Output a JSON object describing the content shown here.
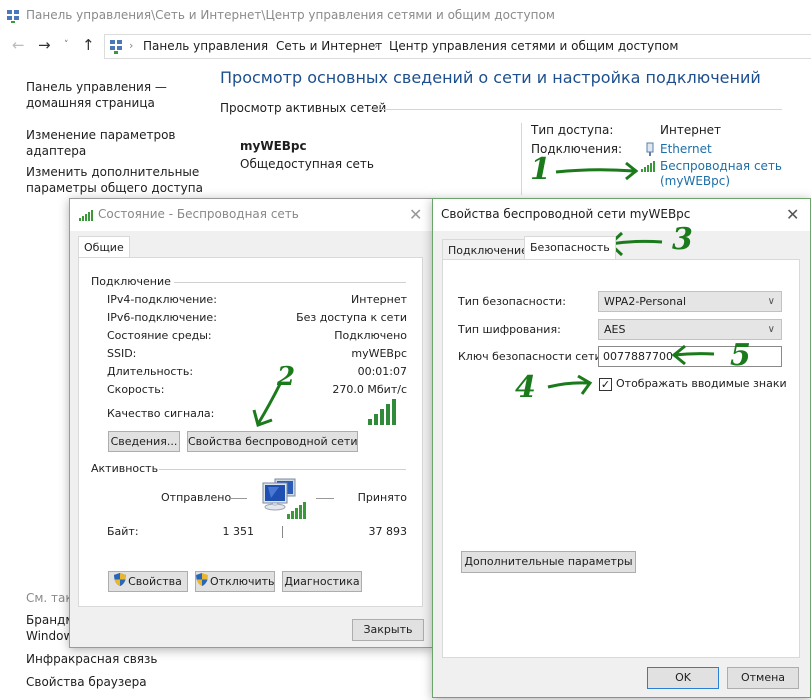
{
  "window": {
    "title": "Панель управления\\Сеть и Интернет\\Центр управления сетями и общим доступом",
    "nav": {
      "back_icon": "arrow-left-icon",
      "forward_icon": "arrow-right-icon",
      "recent_icon": "chevron-down-icon",
      "up_icon": "arrow-up-icon"
    },
    "breadcrumb": [
      "Панель управления",
      "Сеть и Интернет",
      "Центр управления сетями и общим доступом"
    ],
    "breadcrumb_separator": "›"
  },
  "sidebar": {
    "links": [
      {
        "line1": "Панель управления —",
        "line2": "домашняя страница"
      },
      {
        "line1": "Изменение параметров",
        "line2": "адаптера"
      },
      {
        "line1": "Изменить дополнительные",
        "line2": "параметры общего доступа"
      }
    ],
    "see_also_label": "См. также",
    "see_also": [
      {
        "line1": "Брандмауэр",
        "line2": "Windows"
      },
      {
        "line1": "Инфракрасная связь"
      },
      {
        "line1": "Свойства браузера"
      }
    ]
  },
  "main": {
    "title": "Просмотр основных сведений о сети и настройка подключений",
    "active_networks_label": "Просмотр активных сетей",
    "network": {
      "name": "myWEBpc",
      "type": "Общедоступная сеть",
      "access_type_label": "Тип доступа:",
      "access_type_value": "Интернет",
      "connections_label": "Подключения:",
      "connections": [
        {
          "label": "Ethernet",
          "icon": "ethernet-icon"
        },
        {
          "label": "Беспроводная сеть",
          "label2": "(myWEBpc)",
          "icon": "wifi-signal-icon"
        }
      ]
    }
  },
  "status_dialog": {
    "title": "Состояние - Беспроводная сеть",
    "close_icon": "close-icon",
    "tab": "Общие",
    "connection_group": "Подключение",
    "rows": [
      {
        "label": "IPv4-подключение:",
        "value": "Интернет"
      },
      {
        "label": "IPv6-подключение:",
        "value": "Без доступа к сети"
      },
      {
        "label": "Состояние среды:",
        "value": "Подключено"
      },
      {
        "label": "SSID:",
        "value": "myWEBpc"
      },
      {
        "label": "Длительность:",
        "value": "00:01:07"
      },
      {
        "label": "Скорость:",
        "value": "270.0 Мбит/с"
      }
    ],
    "signal_label": "Качество сигнала:",
    "signal_bars": 5,
    "signal_bars_max": 5,
    "details_button": "Сведения...",
    "wireless_props_button": "Свойства беспроводной сети",
    "activity_group": "Активность",
    "sent_label": "Отправлено",
    "received_label": "Принято",
    "bytes_label": "Байт:",
    "bytes_sent": "1 351",
    "bytes_received": "37 893",
    "properties_button": "Свойства",
    "disable_button": "Отключить",
    "diagnose_button": "Диагностика",
    "close_button": "Закрыть"
  },
  "props_dialog": {
    "title": "Свойства беспроводной сети myWEBpc",
    "close_icon": "close-icon",
    "tabs": [
      "Подключение",
      "Безопасность"
    ],
    "active_tab": "Безопасность",
    "security_type_label": "Тип безопасности:",
    "security_type_value": "WPA2-Personal",
    "encryption_type_label": "Тип шифрования:",
    "encryption_type_value": "AES",
    "key_label": "Ключ безопасности сети",
    "key_value": "0077887700",
    "show_chars_label": "Отображать вводимые знаки",
    "show_chars_checked": true,
    "advanced_button": "Дополнительные параметры",
    "ok_button": "OK",
    "cancel_button": "Отмена"
  },
  "annotations": [
    "1",
    "2",
    "3",
    "4",
    "5"
  ],
  "colors": {
    "link": "#1d6fa8",
    "title_blue": "#1d4f8e",
    "annotation_green": "#1b7a1b",
    "signal_green": "#3a9a3a"
  }
}
